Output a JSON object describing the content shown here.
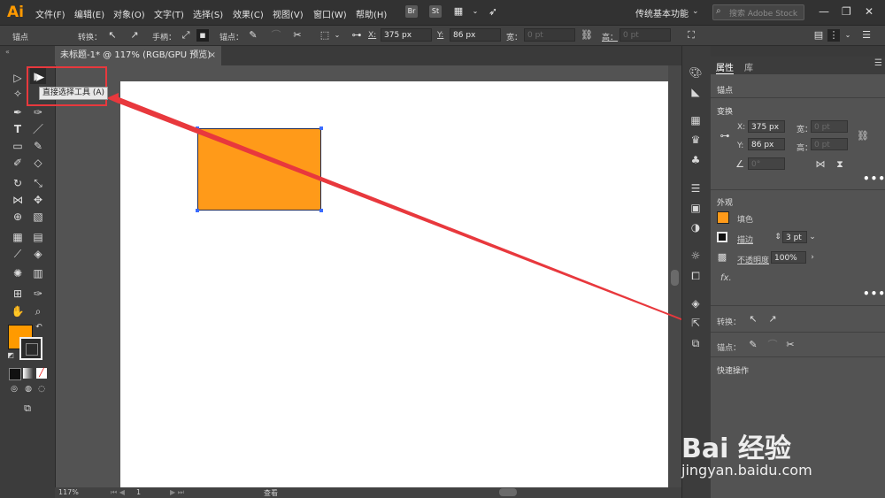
{
  "app": {
    "logo": "Ai"
  },
  "menu": [
    "文件(F)",
    "编辑(E)",
    "对象(O)",
    "文字(T)",
    "选择(S)",
    "效果(C)",
    "视图(V)",
    "窗口(W)",
    "帮助(H)"
  ],
  "menubar_icons": {
    "bridge": "Br",
    "stock": "St"
  },
  "workspace": {
    "label": "传统基本功能"
  },
  "search": {
    "placeholder": "搜索 Adobe Stock"
  },
  "window_controls": {
    "minimize": "—",
    "restore": "❐",
    "close": "✕"
  },
  "control_bar": {
    "selection": "锚点",
    "convert_label": "转换：",
    "handle_label": "手柄：",
    "anchor_label": "锚点：",
    "x_label": "X:",
    "x_value": "375 px",
    "y_label": "Y:",
    "y_value": "86 px",
    "width_label": "宽：",
    "width_value": "0 pt",
    "height_label": "高：",
    "height_value": "0 pt"
  },
  "document_tab": {
    "title": "未标题-1* @ 117% (RGB/GPU 预览)",
    "close": "×"
  },
  "tooltip": {
    "text": "直接选择工具 (A)"
  },
  "status_bar": {
    "zoom": "117%",
    "page": "1",
    "mode": "查看"
  },
  "panel": {
    "tabs": [
      "属性",
      "库"
    ],
    "selection_type": "锚点",
    "transform": {
      "title": "变换",
      "x_label": "X:",
      "x_value": "375 px",
      "y_label": "Y:",
      "y_value": "86 px",
      "w_label": "宽：",
      "w_value": "0 pt",
      "h_label": "高：",
      "h_value": "0 pt",
      "angle_value": "0°"
    },
    "appearance": {
      "title": "外观",
      "fill_label": "填色",
      "stroke_label": "描边",
      "stroke_weight": "3 pt",
      "opacity_label": "不透明度",
      "opacity_value": "100%",
      "fx_label": "fx."
    },
    "anchor_ops": {
      "convert_label": "转换：",
      "anchor_label": "锚点："
    },
    "quick_actions": {
      "title": "快速操作"
    }
  },
  "colors": {
    "fill": "#ff9a19",
    "stroke": "#1e2a55",
    "annotation": "#e8383d",
    "ui_dark": "#323232",
    "ui_mid": "#535353"
  },
  "watermark": {
    "brand": "Bai 经验",
    "url": "jingyan.baidu.com"
  }
}
